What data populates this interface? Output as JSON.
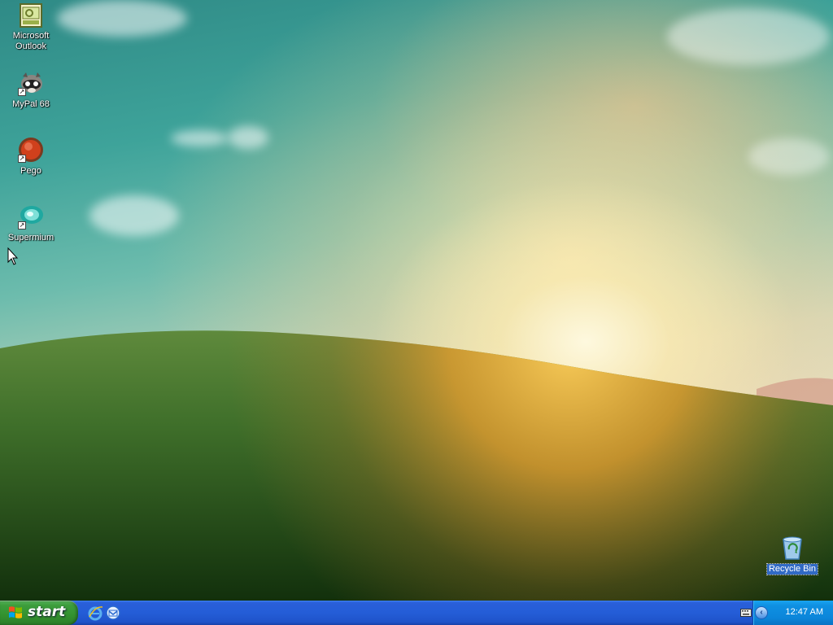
{
  "desktop": {
    "icons": [
      {
        "label": "Microsoft Outlook",
        "icon": "outlook-icon",
        "shortcut": false
      },
      {
        "label": "MyPal 68",
        "icon": "mypal-icon",
        "shortcut": true
      },
      {
        "label": "Pego",
        "icon": "pego-icon",
        "shortcut": true
      },
      {
        "label": "Supermium",
        "icon": "supermium-icon",
        "shortcut": true
      }
    ],
    "recycle_bin": {
      "label": "Recycle Bin",
      "icon": "recycle-bin-icon",
      "selected": true
    }
  },
  "taskbar": {
    "start_label": "start",
    "quick_launch": [
      "internet-explorer-icon",
      "outlook-express-icon"
    ],
    "tray": {
      "clock": "12:47 AM",
      "icons": [
        "keyboard-icon",
        "show-hidden-icons-chevron"
      ]
    },
    "colors": {
      "taskbar": "#245dd7",
      "start": "#3c9d3c",
      "tray": "#0f90e2"
    }
  }
}
